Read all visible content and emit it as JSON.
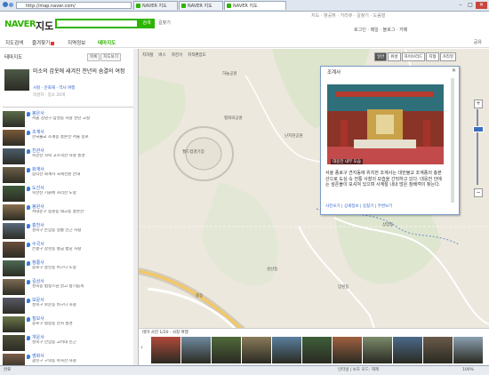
{
  "browser": {
    "address": "http://map.naver.com/",
    "tabs": [
      {
        "label": "NAVER 지도",
        "active": false
      },
      {
        "label": "NAVER 지도",
        "active": false
      },
      {
        "label": "NAVER 지도",
        "active": true
      }
    ],
    "window_buttons": [
      "–",
      "□",
      "✕"
    ]
  },
  "header": {
    "logo": "NAVER",
    "section": "지도",
    "search_placeholder": "",
    "search_button": "검색",
    "route_button": "길찾기",
    "top_links": "지도 · 항공뷰 · 거리뷰 · 길찾기 · 도움말",
    "user": "로그인 · 메일 · 블로그 · 카페"
  },
  "menu": {
    "items": [
      "지도검색",
      "즐겨찾기",
      "지역정보",
      "테마지도"
    ],
    "selected_index": 3,
    "share": "공유"
  },
  "panel": {
    "title": "테마지도",
    "buttons": [
      "목록",
      "지도보기"
    ],
    "featured": {
      "title": "미소의 갑옷에 새겨진 천년의 숨결의 여정",
      "sub": "사찰 · 문화재 · 역사 여행",
      "meta": "작성자 · 장소 20개"
    },
    "items": [
      {
        "title": "봉은사",
        "desc": "서울 강남구 삼성동 사찰 천년 고찰"
      },
      {
        "title": "조계사",
        "desc": "한국불교 조계종 총본산 서울 종로"
      },
      {
        "title": "진관사",
        "desc": "북한산 자락 고즈넉한 사찰 풍경"
      },
      {
        "title": "화계사",
        "desc": "삼각산 화계사 국제선원 안내"
      },
      {
        "title": "도선사",
        "desc": "북한산 기슭에 자리한 도량"
      },
      {
        "title": "봉원사",
        "desc": "서대문구 봉원동 태고종 총본산"
      },
      {
        "title": "흥천사",
        "desc": "성북구 돈암동 정릉 인근 사찰"
      },
      {
        "title": "수국사",
        "desc": "은평구 갈현동 황금 법당 사찰"
      },
      {
        "title": "청룡사",
        "desc": "종로구 숭인동 비구니 도량"
      },
      {
        "title": "길상사",
        "desc": "성북동 법정스님 맑고 향기롭게"
      },
      {
        "title": "보문사",
        "desc": "성북구 보문동 비구니 사찰"
      },
      {
        "title": "칠보사",
        "desc": "종로구 평창동 산사 풍경"
      },
      {
        "title": "개운사",
        "desc": "성북구 안암동 고려대 인근"
      },
      {
        "title": "영화사",
        "desc": "광진구 구의동 아차산 사찰"
      }
    ]
  },
  "map": {
    "toolbar": [
      "지하철",
      "버스",
      "자전거",
      "지적편집도"
    ],
    "types": [
      "일반",
      "위성",
      "하이브리드",
      "지형",
      "거리뷰"
    ],
    "active_type_index": 0,
    "labels": [
      "월드컵경기장",
      "평화의공원",
      "하늘공원",
      "난지천공원",
      "상암동",
      "성산동",
      "망원동",
      "중동",
      "수색동"
    ],
    "popup": {
      "title": "조계사",
      "caption": "대웅전 내부 모습",
      "text": "서울 종로구 견지동에 위치한 조계사는 대한불교 조계종의 총본산으로 도심 속 전통 사찰의 모습을 간직하고 있다. 대웅전 안에는 삼존불이 모셔져 있으며 사계절 내내 많은 참배객이 찾는다.",
      "links": [
        "사진보기",
        "상세정보",
        "길찾기",
        "주변보기"
      ]
    },
    "strip": {
      "caption": "테마 사진 1/20 · 사찰 여행",
      "prev": "‹",
      "next": "›"
    }
  },
  "status": {
    "left": "완료",
    "mid": "인터넷 | 보호 모드: 해제",
    "zoom": "100%"
  }
}
